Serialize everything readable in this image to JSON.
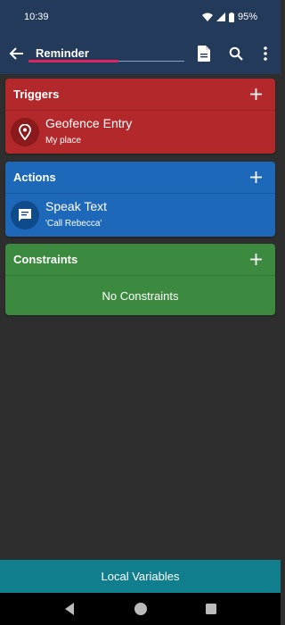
{
  "status": {
    "time": "10:39",
    "battery": "95%"
  },
  "header": {
    "title": "Reminder"
  },
  "triggers": {
    "title": "Triggers",
    "items": [
      {
        "title": "Geofence Entry",
        "subtitle": "My place",
        "icon": "location-pin-icon"
      }
    ]
  },
  "actions": {
    "title": "Actions",
    "items": [
      {
        "title": "Speak Text",
        "subtitle": "'Call Rebecca'",
        "icon": "chat-icon"
      }
    ]
  },
  "constraints": {
    "title": "Constraints",
    "empty": "No Constraints"
  },
  "bottom": {
    "label": "Local Variables"
  },
  "colors": {
    "app_bar": "#243a5a",
    "triggers": "#b3292b",
    "actions": "#1d68b8",
    "constraints": "#3c8a3f",
    "bottom_bar": "#117e8e",
    "background": "#2e2e2e"
  }
}
